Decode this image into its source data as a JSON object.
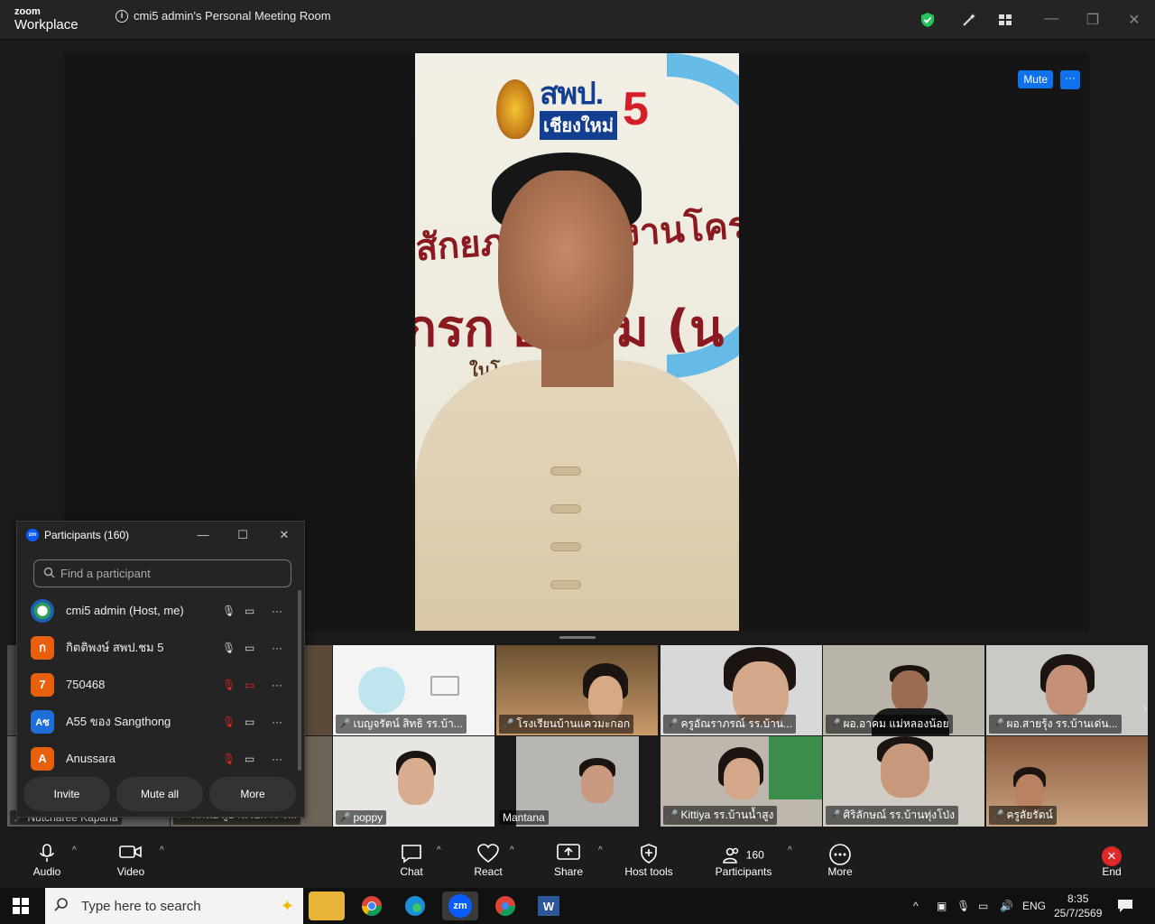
{
  "app": {
    "logo_small": "zoom",
    "logo_big": "Workplace",
    "title": "cmi5 admin's Personal Meeting Room"
  },
  "speaker": {
    "brand_abbrev": "สพป.",
    "brand_city": "เชียงใหม่",
    "brand_num": "5",
    "mute_label": "Mute",
    "more_label": "···"
  },
  "gallery": {
    "tiles": [
      {
        "name": "เบญจรัตน์  สิทธิ รร.บ้า..."
      },
      {
        "name": "โรงเรียนบ้านแควมะกอก"
      },
      {
        "name": "ครูอัณราภรณ์  รร.บ้าน..."
      },
      {
        "name": "ผอ.อาคม  แม่หลองน้อย"
      },
      {
        "name": "ผอ.สายรุ้ง รร.บ้านเด่น..."
      },
      {
        "name": "Nutcharee Kapana"
      },
      {
        "name": "ทัศนีย์ ผู้อำนวยการ ร..."
      },
      {
        "name": "poppy"
      },
      {
        "name": "Mantana"
      },
      {
        "name": "Kittiya รร.บ้านน้ำสูง"
      },
      {
        "name": "ศิริลักษณ์ รร.บ้านทุ่งโป่ง"
      },
      {
        "name": "ครูลัยรัตน์"
      }
    ]
  },
  "participants_panel": {
    "title": "Participants (160)",
    "search_placeholder": "Find a participant",
    "rows": [
      {
        "avatar": "",
        "name": "cmi5 admin (Host, me)",
        "color": "#2a9d5b"
      },
      {
        "avatar": "ก",
        "name": "กิตติพงษ์ สพป.ชม 5",
        "color": "#e8600c"
      },
      {
        "avatar": "7",
        "name": "750468",
        "color": "#e8600c"
      },
      {
        "avatar": "Aซ",
        "name": "A55 ของ Sangthong",
        "color": "#1e6fd9"
      },
      {
        "avatar": "A",
        "name": "Anussara",
        "color": "#e8600c"
      }
    ],
    "buttons": {
      "invite": "Invite",
      "mute_all": "Mute all",
      "more": "More"
    }
  },
  "toolbar": {
    "audio": "Audio",
    "video": "Video",
    "chat": "Chat",
    "react": "React",
    "share": "Share",
    "host_tools": "Host tools",
    "participants": "Participants",
    "participants_count": "160",
    "more": "More",
    "end": "End"
  },
  "taskbar": {
    "search_placeholder": "Type here to search",
    "lang": "ENG",
    "time": "8:35",
    "date": "25/7/2569"
  }
}
